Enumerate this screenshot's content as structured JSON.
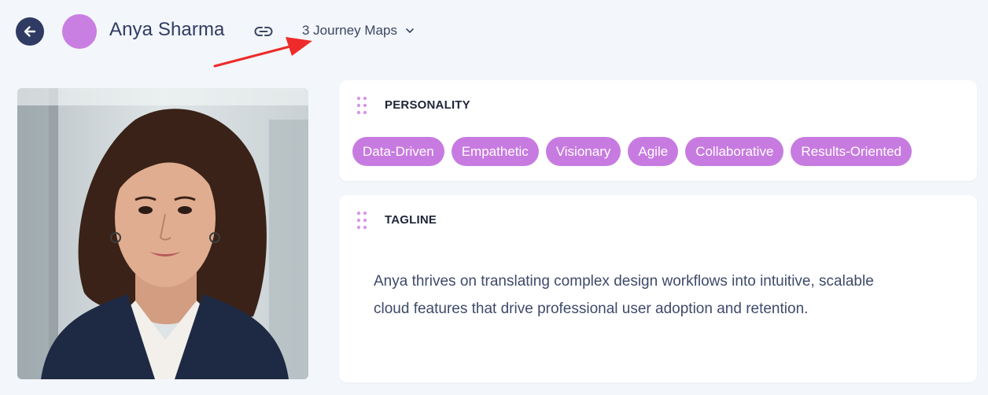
{
  "header": {
    "back_icon": "arrow-left-icon",
    "avatar_color": "#c97fe2",
    "name": "Anya Sharma",
    "link_icon": "link-icon",
    "journey_maps_label": "3 Journey Maps",
    "dropdown_icon": "chevron-down-icon"
  },
  "annotation": {
    "arrow_color": "#ee2a2a"
  },
  "photo": {
    "alt": "Portrait of Anya Sharma"
  },
  "personality": {
    "title": "PERSONALITY",
    "traits": [
      "Data-Driven",
      "Empathetic",
      "Visionary",
      "Agile",
      "Collaborative",
      "Results-Oriented"
    ],
    "chip_color": "#c77be0"
  },
  "tagline": {
    "title": "TAGLINE",
    "text": "Anya thrives on translating complex design workflows into intuitive, scalable cloud features that drive professional user adoption and retention."
  }
}
